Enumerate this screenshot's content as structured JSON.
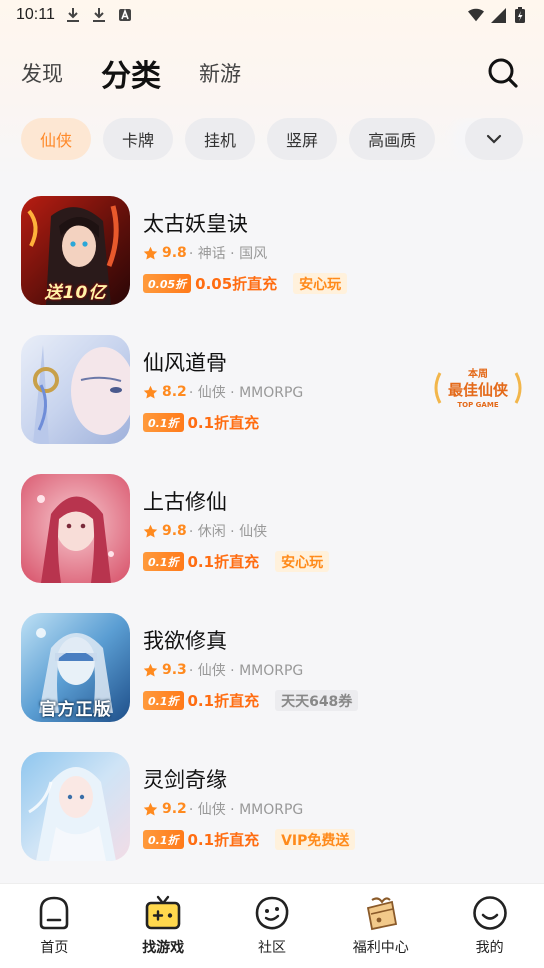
{
  "status_bar": {
    "time": "10:11"
  },
  "top_nav": {
    "tabs": [
      {
        "label": "发现",
        "active": false
      },
      {
        "label": "分类",
        "active": true
      },
      {
        "label": "新游",
        "active": false
      }
    ]
  },
  "categories": [
    "仙侠",
    "卡牌",
    "挂机",
    "竖屏",
    "高画质"
  ],
  "games": [
    {
      "name": "太古妖皇诀",
      "score": "9.8",
      "tags": "· 神话 · 国风",
      "discount_badge": "0.05折",
      "discount_text": "0.05折直充",
      "extra_tag": "安心玩",
      "icon_caption": "送10亿"
    },
    {
      "name": "仙风道骨",
      "score": "8.2",
      "tags": "· 仙侠 · MMORPG",
      "discount_badge": "0.1折",
      "discount_text": "0.1折直充",
      "extra_tag": ""
    },
    {
      "name": "上古修仙",
      "score": "9.8",
      "tags": "· 休闲 · 仙侠",
      "discount_badge": "0.1折",
      "discount_text": "0.1折直充",
      "extra_tag": "安心玩"
    },
    {
      "name": "我欲修真",
      "score": "9.3",
      "tags": "· 仙侠 · MMORPG",
      "discount_badge": "0.1折",
      "discount_text": "0.1折直充",
      "extra_tag": "天天648券",
      "icon_caption": "官方正版"
    },
    {
      "name": "灵剑奇缘",
      "score": "9.2",
      "tags": "· 仙侠 · MMORPG",
      "discount_badge": "0.1折",
      "discount_text": "0.1折直充",
      "extra_tag": "VIP免费送"
    }
  ],
  "best_badge": {
    "line1": "本周",
    "line2": "最佳仙侠",
    "line3": "TOP GAME"
  },
  "bottom_nav": [
    {
      "label": "首页",
      "icon": "home-icon"
    },
    {
      "label": "找游戏",
      "icon": "gamepad-icon",
      "active": true
    },
    {
      "label": "社区",
      "icon": "community-icon"
    },
    {
      "label": "福利中心",
      "icon": "gift-icon"
    },
    {
      "label": "我的",
      "icon": "profile-icon"
    }
  ],
  "colors": {
    "accent": "#ff8a2a",
    "accent_bg": "#fde7d3",
    "score": "#ff8a1f"
  }
}
